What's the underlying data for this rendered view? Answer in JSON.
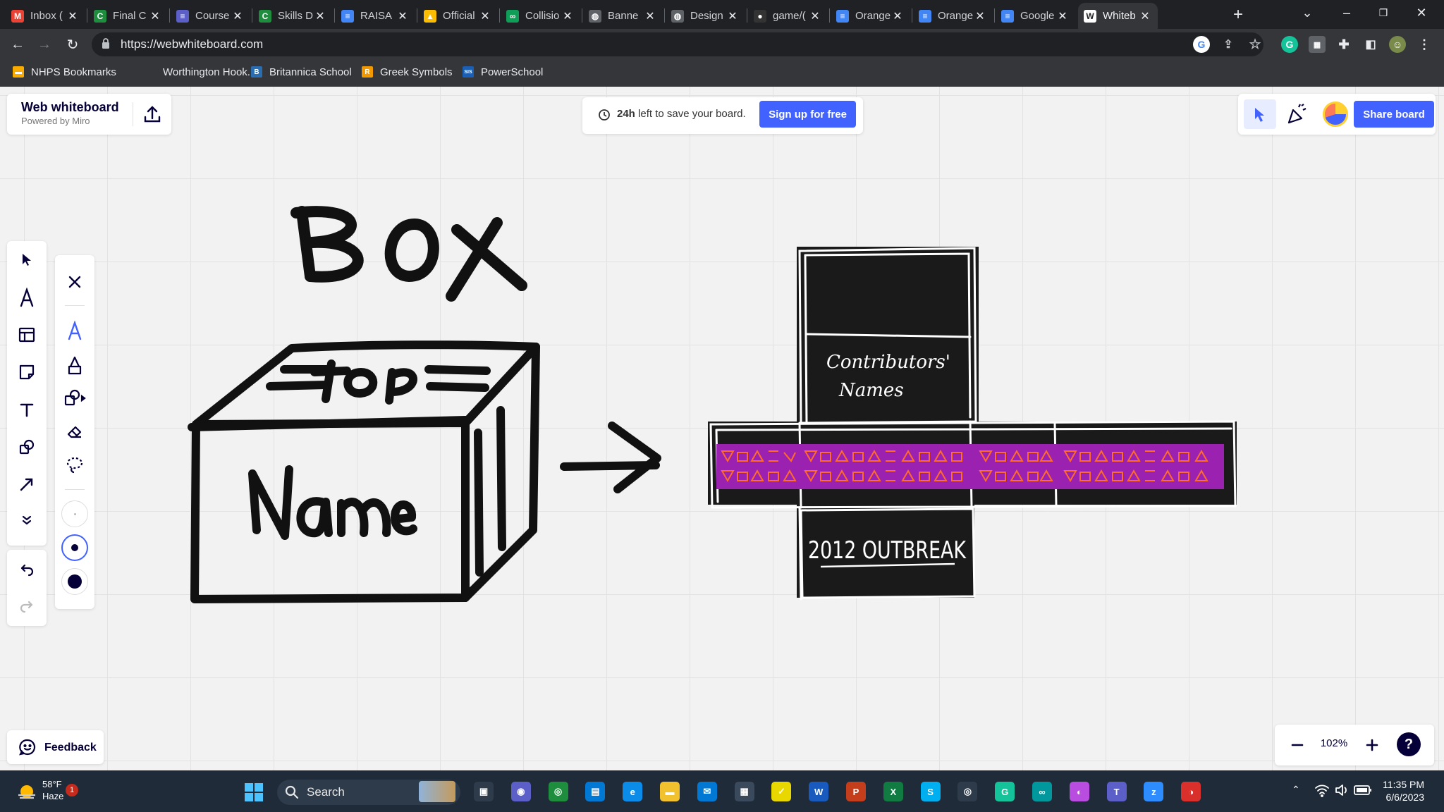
{
  "browser": {
    "tabs": [
      {
        "label": "Inbox (",
        "icon": "gmail-icon",
        "color": "#ea4335",
        "glyph": "M"
      },
      {
        "label": "Final C",
        "icon": "classroom-icon",
        "color": "#1e8e3e",
        "glyph": "C"
      },
      {
        "label": "Course",
        "icon": "course-icon",
        "color": "#5b5fc7",
        "glyph": "≡"
      },
      {
        "label": "Skills D",
        "icon": "classroom-icon",
        "color": "#1e8e3e",
        "glyph": "C"
      },
      {
        "label": "RAISA",
        "icon": "docs-icon",
        "color": "#4285f4",
        "glyph": "≡"
      },
      {
        "label": "Official",
        "icon": "drive-icon",
        "color": "#fbbc04",
        "glyph": "▲"
      },
      {
        "label": "Collisio",
        "icon": "link-icon",
        "color": "#0f9d58",
        "glyph": "∞"
      },
      {
        "label": "Banne",
        "icon": "globe-icon",
        "color": "#5f6368",
        "glyph": "◍"
      },
      {
        "label": "Design",
        "icon": "globe-icon",
        "color": "#5f6368",
        "glyph": "◍"
      },
      {
        "label": "game/(",
        "icon": "github-icon",
        "color": "#333333",
        "glyph": "●"
      },
      {
        "label": "Orange",
        "icon": "docs-icon",
        "color": "#4285f4",
        "glyph": "≡"
      },
      {
        "label": "Orange",
        "icon": "docs-icon",
        "color": "#4285f4",
        "glyph": "≡"
      },
      {
        "label": "Google",
        "icon": "docs-icon",
        "color": "#4285f4",
        "glyph": "≡"
      },
      {
        "label": "Whiteb",
        "icon": "whiteboard-icon",
        "color": "#ffffff",
        "glyph": "W"
      }
    ],
    "url": "https://webwhiteboard.com",
    "bookmarks": [
      {
        "label": "NHPS Bookmarks",
        "color": "#f9ab00",
        "glyph": "▬"
      },
      {
        "label": "Worthington Hook...",
        "color": "#35363a",
        "glyph": ""
      },
      {
        "label": "Britannica School",
        "color": "#2a6db0",
        "glyph": "B"
      },
      {
        "label": "Greek Symbols",
        "color": "#f29900",
        "glyph": "R"
      },
      {
        "label": "PowerSchool",
        "color": "#1a5fb4",
        "glyph": "SIS"
      }
    ]
  },
  "app": {
    "brand_title": "Web whiteboard",
    "brand_subtitle": "Powered by Miro",
    "save_notice_bold": "24h",
    "save_notice": "left to save your board.",
    "signup_label": "Sign up for free",
    "share_label": "Share board",
    "zoom": "102%",
    "feedback_label": "Feedback",
    "help_glyph": "?"
  },
  "drawing": {
    "title_text": "BOX",
    "lid_text": "top",
    "front_text": "Name",
    "net_top_text_line1": "Contributors'",
    "net_top_text_line2": "Names",
    "net_bottom_text": "2012 OUTBREAK"
  },
  "colors": {
    "accent": "#4262ff",
    "band": "#9b22b0",
    "band_symbols": "#ff6a2b",
    "net_fill": "#1a1a1a"
  },
  "taskbar": {
    "weather_temp": "58°F",
    "weather_desc": "Haze",
    "weather_badge": "1",
    "search_label": "Search",
    "time": "11:35 PM",
    "date": "6/6/2023"
  }
}
